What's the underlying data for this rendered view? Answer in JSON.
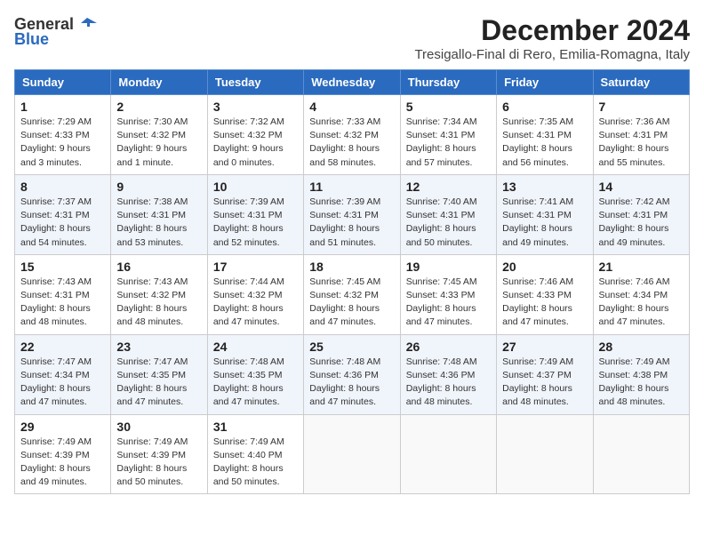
{
  "header": {
    "logo_general": "General",
    "logo_blue": "Blue",
    "month": "December 2024",
    "location": "Tresigallo-Final di Rero, Emilia-Romagna, Italy"
  },
  "weekdays": [
    "Sunday",
    "Monday",
    "Tuesday",
    "Wednesday",
    "Thursday",
    "Friday",
    "Saturday"
  ],
  "weeks": [
    [
      {
        "day": "1",
        "sunrise": "Sunrise: 7:29 AM",
        "sunset": "Sunset: 4:33 PM",
        "daylight": "Daylight: 9 hours and 3 minutes."
      },
      {
        "day": "2",
        "sunrise": "Sunrise: 7:30 AM",
        "sunset": "Sunset: 4:32 PM",
        "daylight": "Daylight: 9 hours and 1 minute."
      },
      {
        "day": "3",
        "sunrise": "Sunrise: 7:32 AM",
        "sunset": "Sunset: 4:32 PM",
        "daylight": "Daylight: 9 hours and 0 minutes."
      },
      {
        "day": "4",
        "sunrise": "Sunrise: 7:33 AM",
        "sunset": "Sunset: 4:32 PM",
        "daylight": "Daylight: 8 hours and 58 minutes."
      },
      {
        "day": "5",
        "sunrise": "Sunrise: 7:34 AM",
        "sunset": "Sunset: 4:31 PM",
        "daylight": "Daylight: 8 hours and 57 minutes."
      },
      {
        "day": "6",
        "sunrise": "Sunrise: 7:35 AM",
        "sunset": "Sunset: 4:31 PM",
        "daylight": "Daylight: 8 hours and 56 minutes."
      },
      {
        "day": "7",
        "sunrise": "Sunrise: 7:36 AM",
        "sunset": "Sunset: 4:31 PM",
        "daylight": "Daylight: 8 hours and 55 minutes."
      }
    ],
    [
      {
        "day": "8",
        "sunrise": "Sunrise: 7:37 AM",
        "sunset": "Sunset: 4:31 PM",
        "daylight": "Daylight: 8 hours and 54 minutes."
      },
      {
        "day": "9",
        "sunrise": "Sunrise: 7:38 AM",
        "sunset": "Sunset: 4:31 PM",
        "daylight": "Daylight: 8 hours and 53 minutes."
      },
      {
        "day": "10",
        "sunrise": "Sunrise: 7:39 AM",
        "sunset": "Sunset: 4:31 PM",
        "daylight": "Daylight: 8 hours and 52 minutes."
      },
      {
        "day": "11",
        "sunrise": "Sunrise: 7:39 AM",
        "sunset": "Sunset: 4:31 PM",
        "daylight": "Daylight: 8 hours and 51 minutes."
      },
      {
        "day": "12",
        "sunrise": "Sunrise: 7:40 AM",
        "sunset": "Sunset: 4:31 PM",
        "daylight": "Daylight: 8 hours and 50 minutes."
      },
      {
        "day": "13",
        "sunrise": "Sunrise: 7:41 AM",
        "sunset": "Sunset: 4:31 PM",
        "daylight": "Daylight: 8 hours and 49 minutes."
      },
      {
        "day": "14",
        "sunrise": "Sunrise: 7:42 AM",
        "sunset": "Sunset: 4:31 PM",
        "daylight": "Daylight: 8 hours and 49 minutes."
      }
    ],
    [
      {
        "day": "15",
        "sunrise": "Sunrise: 7:43 AM",
        "sunset": "Sunset: 4:31 PM",
        "daylight": "Daylight: 8 hours and 48 minutes."
      },
      {
        "day": "16",
        "sunrise": "Sunrise: 7:43 AM",
        "sunset": "Sunset: 4:32 PM",
        "daylight": "Daylight: 8 hours and 48 minutes."
      },
      {
        "day": "17",
        "sunrise": "Sunrise: 7:44 AM",
        "sunset": "Sunset: 4:32 PM",
        "daylight": "Daylight: 8 hours and 47 minutes."
      },
      {
        "day": "18",
        "sunrise": "Sunrise: 7:45 AM",
        "sunset": "Sunset: 4:32 PM",
        "daylight": "Daylight: 8 hours and 47 minutes."
      },
      {
        "day": "19",
        "sunrise": "Sunrise: 7:45 AM",
        "sunset": "Sunset: 4:33 PM",
        "daylight": "Daylight: 8 hours and 47 minutes."
      },
      {
        "day": "20",
        "sunrise": "Sunrise: 7:46 AM",
        "sunset": "Sunset: 4:33 PM",
        "daylight": "Daylight: 8 hours and 47 minutes."
      },
      {
        "day": "21",
        "sunrise": "Sunrise: 7:46 AM",
        "sunset": "Sunset: 4:34 PM",
        "daylight": "Daylight: 8 hours and 47 minutes."
      }
    ],
    [
      {
        "day": "22",
        "sunrise": "Sunrise: 7:47 AM",
        "sunset": "Sunset: 4:34 PM",
        "daylight": "Daylight: 8 hours and 47 minutes."
      },
      {
        "day": "23",
        "sunrise": "Sunrise: 7:47 AM",
        "sunset": "Sunset: 4:35 PM",
        "daylight": "Daylight: 8 hours and 47 minutes."
      },
      {
        "day": "24",
        "sunrise": "Sunrise: 7:48 AM",
        "sunset": "Sunset: 4:35 PM",
        "daylight": "Daylight: 8 hours and 47 minutes."
      },
      {
        "day": "25",
        "sunrise": "Sunrise: 7:48 AM",
        "sunset": "Sunset: 4:36 PM",
        "daylight": "Daylight: 8 hours and 47 minutes."
      },
      {
        "day": "26",
        "sunrise": "Sunrise: 7:48 AM",
        "sunset": "Sunset: 4:36 PM",
        "daylight": "Daylight: 8 hours and 48 minutes."
      },
      {
        "day": "27",
        "sunrise": "Sunrise: 7:49 AM",
        "sunset": "Sunset: 4:37 PM",
        "daylight": "Daylight: 8 hours and 48 minutes."
      },
      {
        "day": "28",
        "sunrise": "Sunrise: 7:49 AM",
        "sunset": "Sunset: 4:38 PM",
        "daylight": "Daylight: 8 hours and 48 minutes."
      }
    ],
    [
      {
        "day": "29",
        "sunrise": "Sunrise: 7:49 AM",
        "sunset": "Sunset: 4:39 PM",
        "daylight": "Daylight: 8 hours and 49 minutes."
      },
      {
        "day": "30",
        "sunrise": "Sunrise: 7:49 AM",
        "sunset": "Sunset: 4:39 PM",
        "daylight": "Daylight: 8 hours and 50 minutes."
      },
      {
        "day": "31",
        "sunrise": "Sunrise: 7:49 AM",
        "sunset": "Sunset: 4:40 PM",
        "daylight": "Daylight: 8 hours and 50 minutes."
      },
      null,
      null,
      null,
      null
    ]
  ]
}
